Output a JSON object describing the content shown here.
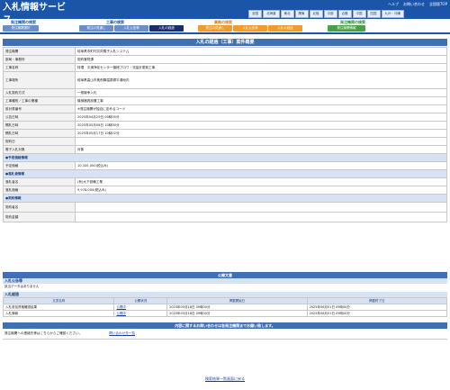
{
  "header": {
    "title": "入札情報サービス",
    "links": [
      "ヘルプ",
      "お問い合わせ",
      "全国版TOP"
    ],
    "regions": [
      "全国",
      "北海道",
      "東北",
      "関東",
      "北陸",
      "中部",
      "近畿",
      "中国",
      "四国",
      "九州・沖縄"
    ]
  },
  "nav": {
    "sections": [
      {
        "title": "発注機関の検索"
      },
      {
        "title": "工事の検索"
      },
      {
        "title": "業務の検索"
      },
      {
        "title": "発注機関の検索"
      }
    ],
    "tabs": [
      {
        "label": "発注機関選択"
      },
      {
        "label": "発注の見通し"
      },
      {
        "label": "入札公告等"
      },
      {
        "label": "入札の経過"
      },
      {
        "label": "発注の見通し"
      },
      {
        "label": "入札公告等"
      },
      {
        "label": "入札の経過"
      },
      {
        "label": "発注機関情報"
      }
    ]
  },
  "page_title": "入札の経過（工事）案件概要",
  "rows": [
    {
      "label": "発注機関",
      "value": "岐阜県市町村共同電子入札システム"
    },
    {
      "label": "部局・事務所",
      "value": "契約管財課"
    },
    {
      "label": "工事名称",
      "value": "特環　平湯浄化センター機械ブロワ・流量計更新工事"
    },
    {
      "label": "工事場所",
      "value": "岐阜県高山市奥飛騨温泉郷平湯地内"
    },
    {
      "label": "入札契約方式",
      "value": "一般競争入札"
    },
    {
      "label": "工事種別／工事の業種",
      "value": "機械器具設置工事"
    },
    {
      "label": "設計書番号",
      "value": "※発注機関が独自に定めるコード"
    },
    {
      "label": "公告日時",
      "value": "2025年04月29日 09時00分"
    },
    {
      "label": "開札日時",
      "value": "2025年05月08日 10時00分"
    },
    {
      "label": "開札日時",
      "value": "2025年05月17日 10時02分"
    },
    {
      "label": "契約日",
      "value": ""
    },
    {
      "label": "電子入札対象",
      "value": "対象"
    }
  ],
  "price_header": "●予定価格情報",
  "price_rows": [
    {
      "label": "予定価格",
      "value": "10,335,000(税込み)"
    }
  ],
  "winner_header": "●落札者情報",
  "winner_rows": [
    {
      "label": "落札者名",
      "value": "(有)大下設備工業"
    },
    {
      "label": "落札価格",
      "value": "9,978,000(税込み)"
    }
  ],
  "contract_header": "●契約情報",
  "contract_rows": [
    {
      "label": "契約者名",
      "value": ""
    },
    {
      "label": "契約金額",
      "value": ""
    }
  ],
  "pub": {
    "title": "公開文書",
    "notice_header": "入札公告等",
    "notice_empty": "該当データはありません",
    "result_header": "入札経過",
    "columns": [
      "文書名称",
      "公開状況",
      "掲載開始日",
      "掲載終了日"
    ],
    "docs": [
      {
        "name": "入札参加資格確認結果",
        "status": "公開中",
        "start": "2025年05月18日 09時00分",
        "end": "2025年06月01日 09時00分"
      },
      {
        "name": "入札情報",
        "status": "公開中",
        "start": "2025年05月18日 09時00分",
        "end": "2025年06月01日 09時00分"
      }
    ]
  },
  "contact": {
    "title": "内容に関するお問い合わせは各発注機関までお願い致します。",
    "label": "発注機関への連絡先等はこちらからご確認ください。",
    "link": "問い合わせ先一覧"
  },
  "bottom_link": "検索結果一覧画面に戻る"
}
